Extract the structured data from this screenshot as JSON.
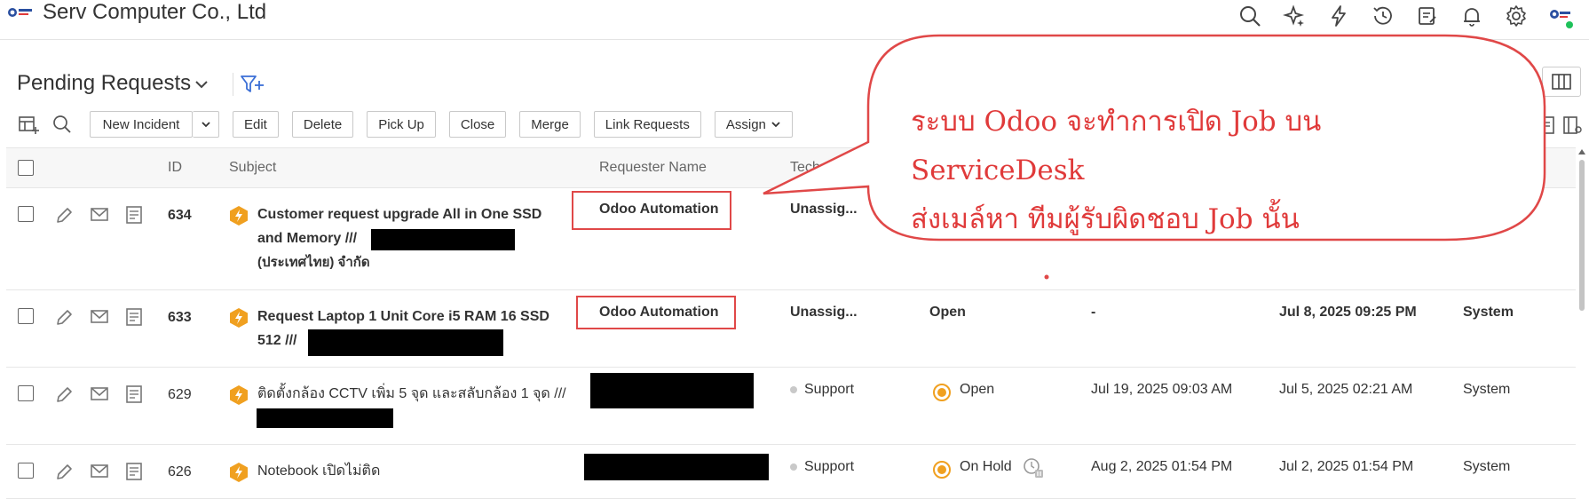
{
  "header": {
    "company": "Serv Computer Co., Ltd",
    "icons": [
      "search-icon",
      "sparkle-icon",
      "lightning-icon",
      "history-icon",
      "checklist-icon",
      "bell-icon",
      "gear-icon",
      "avatar-icon"
    ]
  },
  "view": {
    "title": "Pending Requests"
  },
  "toolbar": {
    "new_incident": "New Incident",
    "edit": "Edit",
    "delete": "Delete",
    "pick_up": "Pick Up",
    "close": "Close",
    "merge": "Merge",
    "link_requests": "Link Requests",
    "assign": "Assign"
  },
  "columns": {
    "id": "ID",
    "subject": "Subject",
    "requester": "Requester Name",
    "technician": "Techn"
  },
  "rows": [
    {
      "id": "634",
      "subject_line1": "Customer request upgrade All in One SSD",
      "subject_line2": "and Memory ///",
      "subject_line3": "(ประเทศไทย) จำกัด",
      "requester": "Odoo Automation",
      "technician": "Unassig..."
    },
    {
      "id": "633",
      "subject_line1": "Request Laptop 1 Unit Core i5 RAM 16 SSD",
      "subject_line2": "512 ///",
      "requester": "Odoo Automation",
      "technician": "Unassig...",
      "status": "Open",
      "due_by": "-",
      "created": "Jul 8, 2025 09:25 PM",
      "created_by": "System"
    },
    {
      "id": "629",
      "subject_line1": "ติดตั้งกล้อง CCTV เพิ่ม 5 จุด และสลับกล้อง 1 จุด ///",
      "technician": "Support",
      "status": "Open",
      "due_by": "Jul 19, 2025 09:03 AM",
      "created": "Jul 5, 2025 02:21 AM",
      "created_by": "System"
    },
    {
      "id": "626",
      "subject_line1": "Notebook เปิดไม่ติด",
      "technician": "Support",
      "status": "On Hold",
      "due_by": "Aug 2, 2025 01:54 PM",
      "created": "Jul 2, 2025 01:54 PM",
      "created_by": "System"
    }
  ],
  "callout": {
    "line1": "ระบบ Odoo จะทำการเปิด Job บน ServiceDesk",
    "line2": "ส่งเมล์หา ทีมผู้รับผิดชอบ Job นั้น"
  },
  "colors": {
    "accent_red": "#e04848",
    "priority_orange": "#f0a020",
    "status_open_orange": "#f0a020",
    "online_green": "#1ec15a"
  }
}
